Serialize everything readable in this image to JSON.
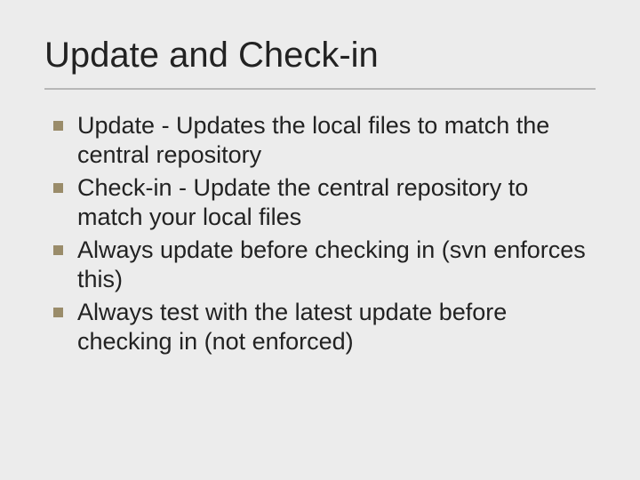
{
  "slide": {
    "title": "Update and Check-in",
    "bullets": [
      "Update - Updates the local files to match the central repository",
      "Check-in - Update the central repository to match your local files",
      "Always update before checking in (svn enforces this)",
      "Always test with the latest update before checking in (not enforced)"
    ]
  }
}
